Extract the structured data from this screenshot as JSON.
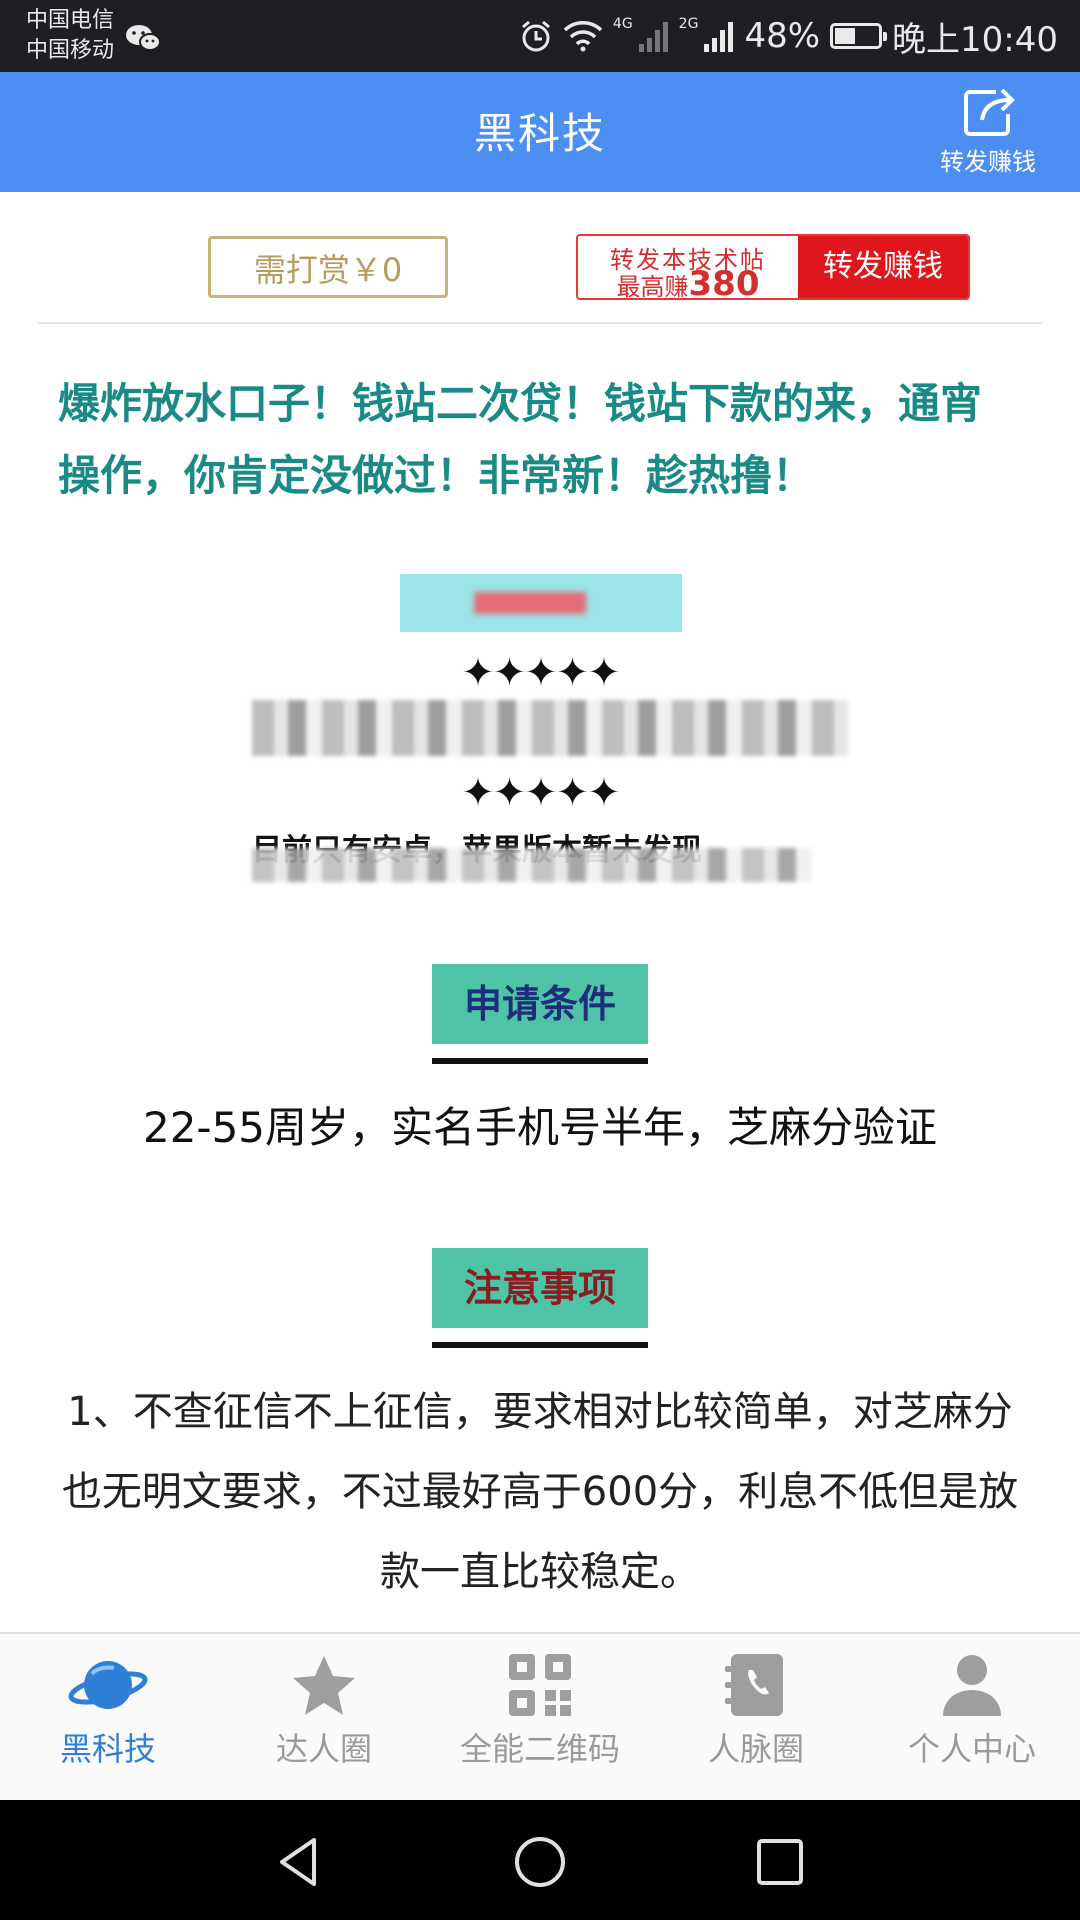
{
  "status_bar": {
    "carrier_1": "中国电信",
    "carrier_2": "中国移动",
    "net_1": "4G",
    "net_2": "2G",
    "battery": "48%",
    "battery_level": 0.48,
    "time": "晚上10:40"
  },
  "app_bar": {
    "title": "黑科技",
    "share_label": "转发赚钱"
  },
  "reward": {
    "tip_label": "需打赏￥0",
    "promo_line1": "转发本技术帖",
    "promo_line2_prefix": "最高赚",
    "promo_amount": "380",
    "forward_button": "转发赚钱"
  },
  "article": {
    "title": "爆炸放水口子！钱站二次贷！钱站下款的来，通宵操作，你肯定没做过！非常新！趁热撸！",
    "stars": "✦✦✦✦✦",
    "partial_line": "目前只有安卓，苹果版本暂未发现",
    "section_1_title": "申请条件",
    "conditions": "22-55周岁，实名手机号半年，芝麻分验证",
    "section_2_title": "注意事项",
    "note_1": "1、不查征信不上征信，要求相对比较简单，对芝麻分也无明文要求，不过最好高于600分，利息不低但是放款一直比较稳定。"
  },
  "bottom_nav": {
    "items": [
      {
        "label": "黑科技",
        "icon": "planet-icon",
        "active": true
      },
      {
        "label": "达人圈",
        "icon": "star-icon",
        "active": false
      },
      {
        "label": "全能二维码",
        "icon": "qr-code-icon",
        "active": false
      },
      {
        "label": "人脉圈",
        "icon": "phone-book-icon",
        "active": false
      },
      {
        "label": "个人中心",
        "icon": "person-icon",
        "active": false
      }
    ]
  },
  "colors": {
    "app_bar": "#4c8ef2",
    "title_teal": "#1a8a86",
    "badge_green": "#4fc3a6",
    "promo_red": "#e0161e",
    "nav_active": "#2f7fd6"
  }
}
